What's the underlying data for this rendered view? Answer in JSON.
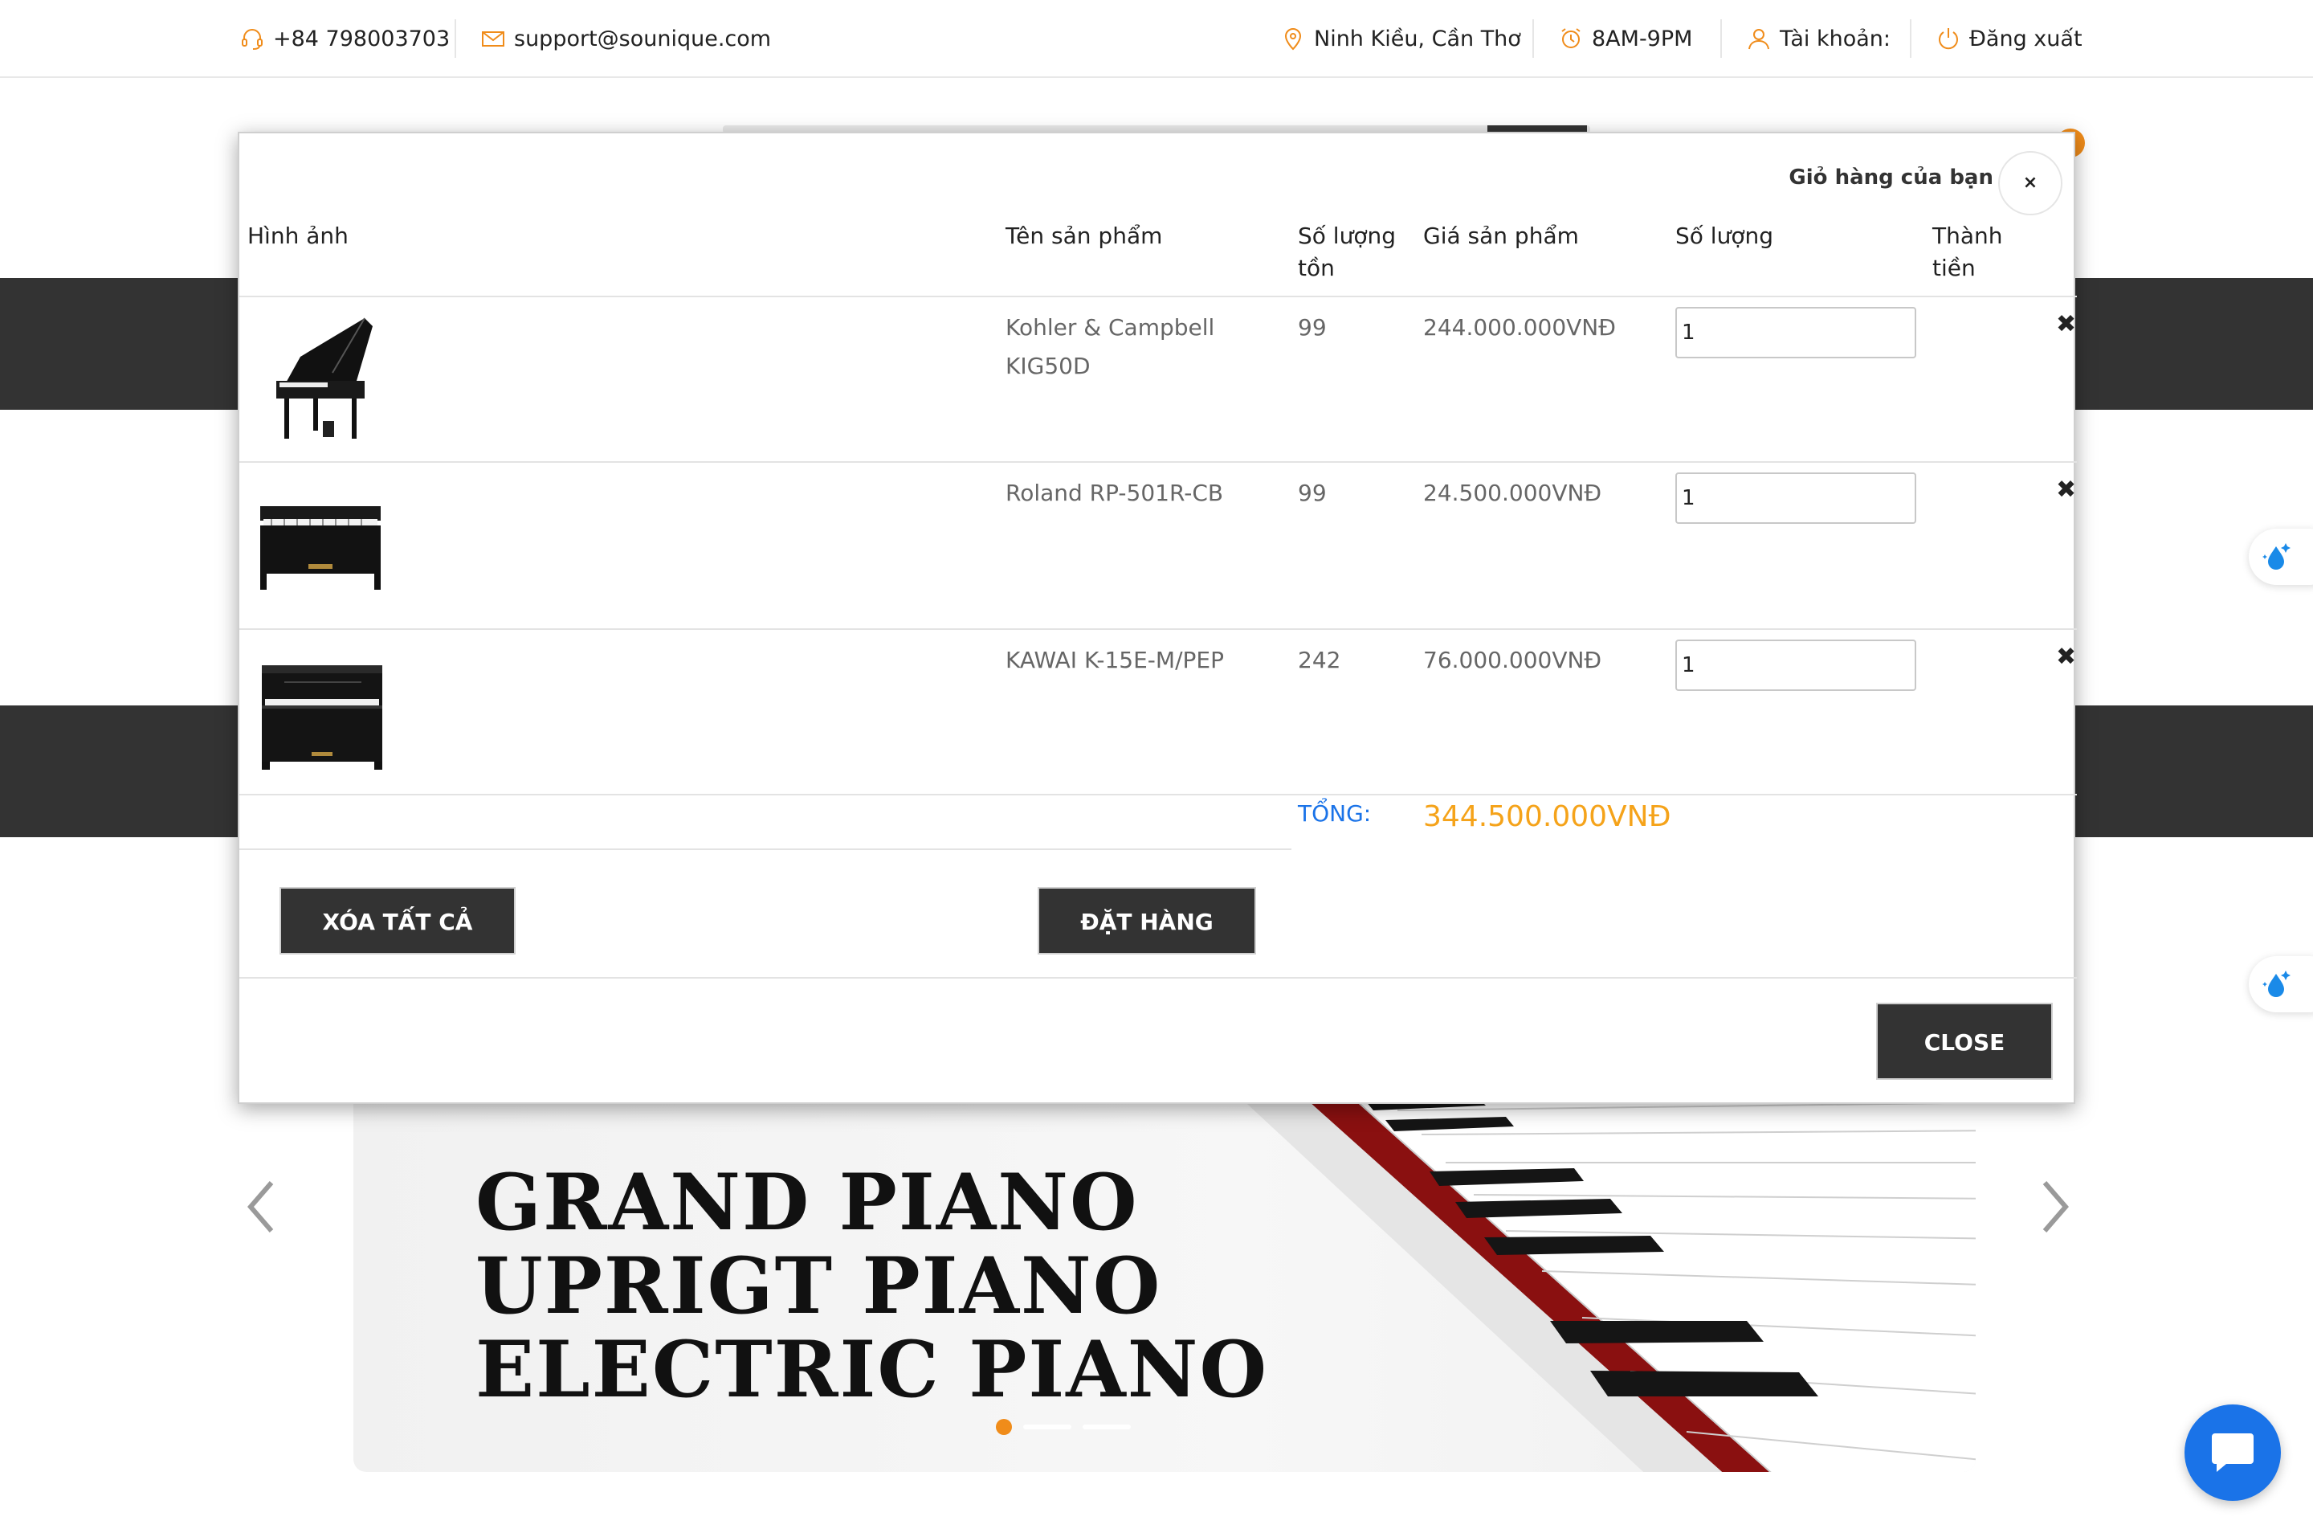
{
  "topbar": {
    "phone": "+84 798003703",
    "email": "support@sounique.com",
    "location": "Ninh Kiều, Cần Thơ",
    "hours": "8AM-9PM",
    "account": "Tài khoản:",
    "logout": "Đăng xuất",
    "icon_color": "#f08c1a"
  },
  "hero": {
    "lines": [
      "GRAND PIANO",
      "UPRIGT PIANO",
      "ELECTRIC PIANO"
    ],
    "active_slide": 1,
    "slide_count": 3
  },
  "cart_modal": {
    "title": "Giỏ hàng của bạn",
    "close_x": "×",
    "columns": {
      "image": "Hình ảnh",
      "name": "Tên sản phẩm",
      "stock_line1": "Số lượng",
      "stock_line2": "tồn",
      "price": "Giá sản phẩm",
      "qty": "Số lượng",
      "subtotal_line1": "Thành",
      "subtotal_line2": "tiền"
    },
    "items": [
      {
        "name_line1": "Kohler & Campbell",
        "name_line2": "KIG50D",
        "stock": "99",
        "price": "244.000.000VNĐ",
        "qty": "1",
        "delete": "✖",
        "image": "grand-piano-icon"
      },
      {
        "name_line1": "Roland RP-501R-CB",
        "name_line2": "",
        "stock": "99",
        "price": "24.500.000VNĐ",
        "qty": "1",
        "delete": "✖",
        "image": "digital-piano-icon"
      },
      {
        "name_line1": "KAWAI K-15E-M/PEP",
        "name_line2": "",
        "stock": "242",
        "price": "76.000.000VNĐ",
        "qty": "1",
        "delete": "✖",
        "image": "upright-piano-icon"
      }
    ],
    "total_label": "TỔNG:",
    "total_value": "344.500.000VNĐ",
    "clear_all": "XÓA TẤT CẢ",
    "order": "ĐẶT HÀNG",
    "close": "CLOSE",
    "total_label_color": "#1a73e8",
    "total_value_color": "#f5a31a"
  }
}
